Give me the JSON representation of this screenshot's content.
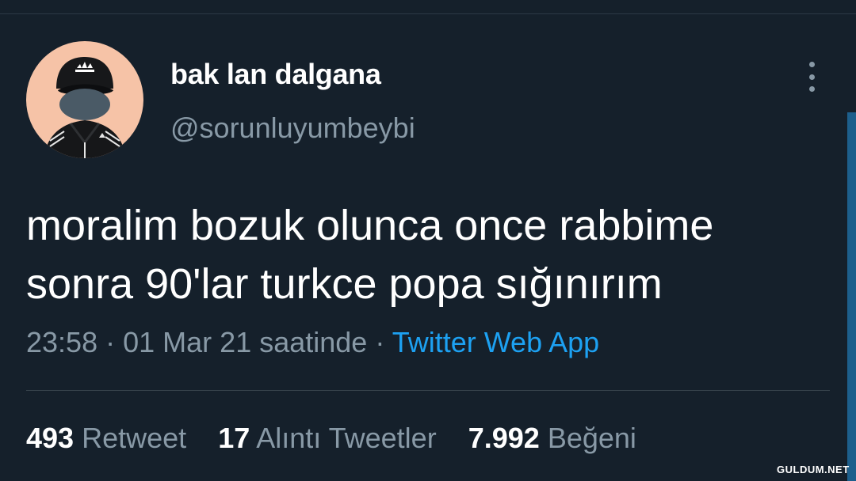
{
  "tweet": {
    "display_name": "bak lan dalgana",
    "handle": "@sorunluyumbeybi",
    "text_lines": [
      "moralim bozuk olunca once rabbime",
      "sonra 90'lar turkce popa sığınırım"
    ],
    "time": "23:58",
    "date_text": "01 Mar 21 saatinde",
    "separator": "·",
    "source": "Twitter Web App"
  },
  "stats": {
    "retweets": {
      "count": "493",
      "label": "Retweet"
    },
    "quotes": {
      "count": "17",
      "label": "Alıntı Tweetler"
    },
    "likes": {
      "count": "7.992",
      "label": "Beğeni"
    }
  },
  "watermark": "GULDUM.NET",
  "colors": {
    "background": "#15202b",
    "text": "#ffffff",
    "secondary_text": "#8899a6",
    "link": "#1da1f2",
    "avatar_bg": "#f6c3a7"
  },
  "icons": {
    "more": "more-vertical-icon"
  }
}
